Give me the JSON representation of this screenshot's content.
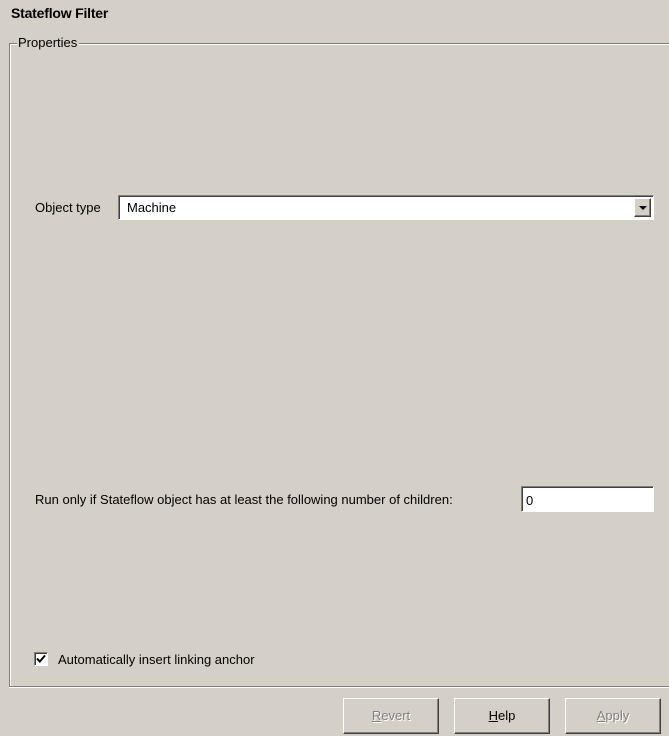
{
  "panel": {
    "title": "Stateflow Filter",
    "group_label": "Properties"
  },
  "fields": {
    "object_type_label": "Object type",
    "object_type_value": "Machine",
    "children_label": "Run only if Stateflow object has at least the following number of children:",
    "children_value": "0",
    "anchor_checkbox_label": "Automatically insert linking anchor",
    "anchor_checkbox_checked": true
  },
  "buttons": {
    "revert": {
      "mnemonic": "R",
      "rest": "evert",
      "enabled": false
    },
    "help": {
      "mnemonic": "H",
      "rest": "elp",
      "enabled": true
    },
    "apply": {
      "mnemonic": "A",
      "rest": "pply",
      "enabled": false
    }
  },
  "icons": {
    "dropdown": "chevron-down-icon",
    "check": "checkmark-icon"
  }
}
